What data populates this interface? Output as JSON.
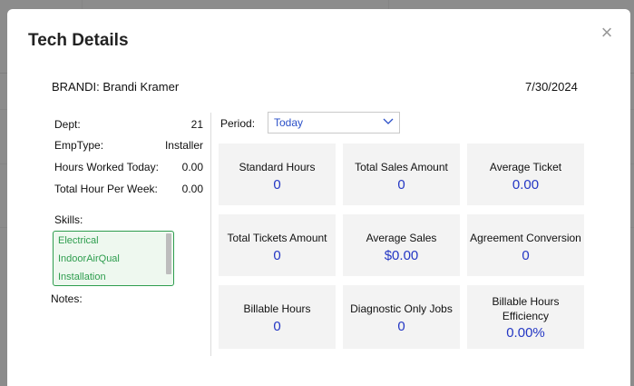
{
  "modal": {
    "title": "Tech Details",
    "close_glyph": "×"
  },
  "tech": {
    "name": "BRANDI: Brandi Kramer",
    "date": "7/30/2024"
  },
  "info": [
    {
      "label": "Dept:",
      "value": "21"
    },
    {
      "label": "EmpType:",
      "value": "Installer"
    },
    {
      "label": "Hours Worked Today:",
      "value": "0.00"
    },
    {
      "label": "Total Hour Per Week:",
      "value": "0.00"
    }
  ],
  "skills": {
    "label": "Skills:",
    "items": [
      "Electrical",
      "IndoorAirQual",
      "Installation"
    ]
  },
  "notes": {
    "label": "Notes:"
  },
  "period": {
    "label": "Period:",
    "selected": "Today"
  },
  "tiles": [
    {
      "label": "Standard Hours",
      "value": "0"
    },
    {
      "label": "Total Sales Amount",
      "value": "0"
    },
    {
      "label": "Average Ticket",
      "value": "0.00"
    },
    {
      "label": "Total Tickets Amount",
      "value": "0"
    },
    {
      "label": "Average Sales",
      "value": "$0.00"
    },
    {
      "label": "Agreement Conversion",
      "value": "0"
    },
    {
      "label": "Billable Hours",
      "value": "0"
    },
    {
      "label": "Diagnostic Only Jobs",
      "value": "0"
    },
    {
      "label": "Billable Hours Efficiency",
      "value": "0.00%"
    }
  ],
  "colors": {
    "value_blue": "#2437c4",
    "skills_green": "#2e9d4e",
    "tile_bg": "#f3f3f3"
  }
}
